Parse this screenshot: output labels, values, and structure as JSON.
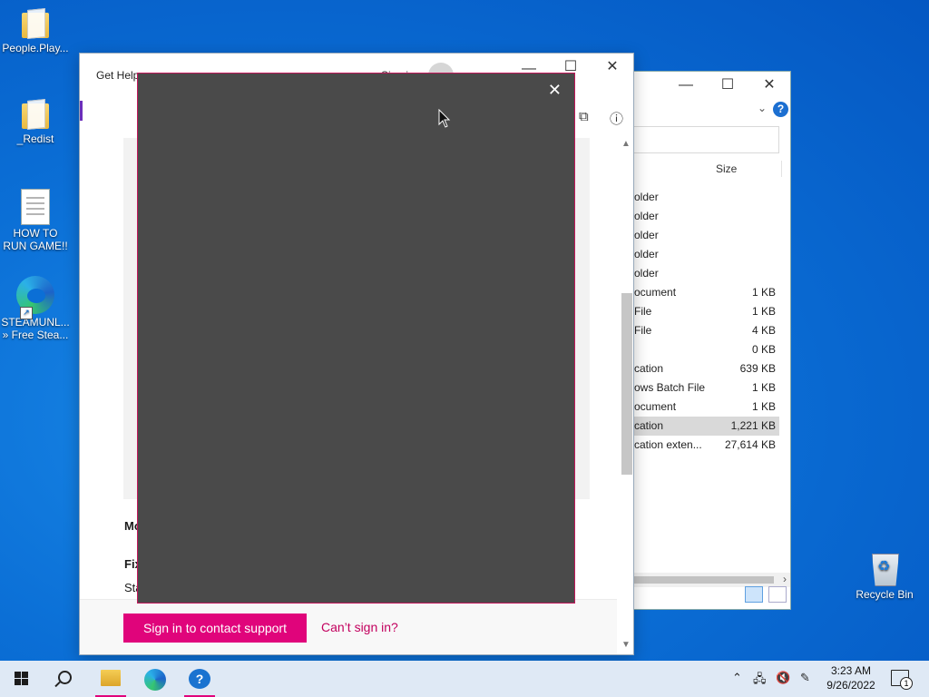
{
  "desktop": {
    "icons": [
      {
        "label": "People.Play..."
      },
      {
        "label": "_Redist"
      },
      {
        "label": "HOW TO RUN GAME!!"
      },
      {
        "label": "STEAMUNL... » Free Stea..."
      }
    ],
    "recycle_bin": {
      "label": "Recycle Bin"
    }
  },
  "explorer": {
    "column_size": "Size",
    "rows": [
      {
        "type": "older",
        "size": ""
      },
      {
        "type": "older",
        "size": ""
      },
      {
        "type": "older",
        "size": ""
      },
      {
        "type": "older",
        "size": ""
      },
      {
        "type": "older",
        "size": ""
      },
      {
        "type": "ocument",
        "size": "1 KB"
      },
      {
        "type": "File",
        "size": "1 KB"
      },
      {
        "type": "File",
        "size": "4 KB"
      },
      {
        "type": "",
        "size": "0 KB"
      },
      {
        "type": "cation",
        "size": "639 KB"
      },
      {
        "type": "ows Batch File",
        "size": "1 KB"
      },
      {
        "type": "ocument",
        "size": "1 KB"
      },
      {
        "type": "cation",
        "size": "1,221 KB",
        "selected": true
      },
      {
        "type": "cation exten...",
        "size": "27,614 KB"
      }
    ]
  },
  "gethelp": {
    "title": "Get Help",
    "signin_partial": "Sign i",
    "section_more": "Mo",
    "section_fix": "Fix",
    "line_start": "Sta",
    "signin_button": "Sign in to contact support",
    "cant_signin_link": "Can’t sign in?",
    "accent_color": "#e0047b"
  },
  "overlay": {
    "close_label": "✕"
  },
  "taskbar": {
    "time": "3:23 AM",
    "date": "9/26/2022",
    "notification_count": "1"
  }
}
